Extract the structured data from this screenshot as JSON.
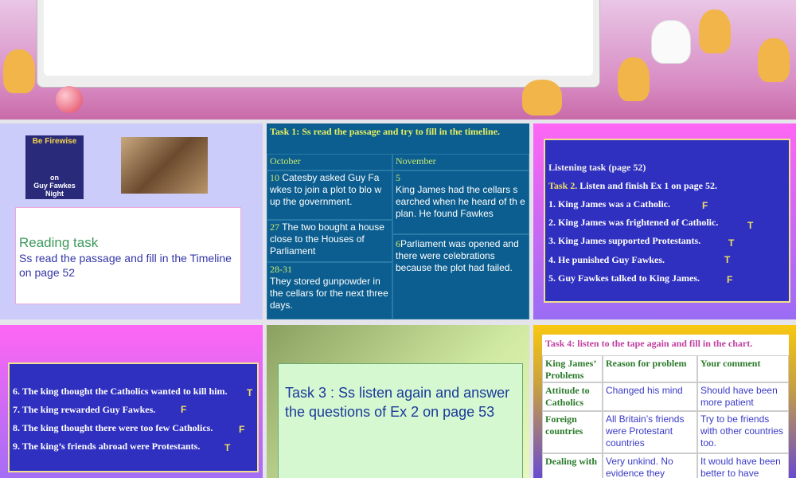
{
  "slide2": {
    "logo_top": "Be Firewise",
    "logo_mid": "on",
    "logo_bottom": "Guy Fawkes Night",
    "heading": "Reading task",
    "text": "Ss read the passage and fill in the Timeline on page 52"
  },
  "slide3": {
    "title": "Task 1: Ss read the passage and try to fill in the timeline.",
    "col1": "October",
    "col2": "November",
    "oct": [
      {
        "day": "10",
        "text": "Catesby asked Guy Fa wkes to join a plot to blo w up the government."
      },
      {
        "day": "27",
        "text": "The two bought a house close to the Houses of Parliament"
      },
      {
        "day": "28-31",
        "text": "They stored gunpowder in the cellars for the next three days."
      }
    ],
    "nov": [
      {
        "day": "5",
        "text": "King James had the cellars s earched when he heard of th e plan. He found Fawkes"
      },
      {
        "day": "6",
        "text": "Parliament was opened and there were celebrations because the plot had failed."
      }
    ]
  },
  "slide4": {
    "heading": "Listening task (page 52)",
    "task_label": "Task 2.",
    "task_text": " Listen and finish Ex 1 on page 52.",
    "items": [
      {
        "text": "1.  King James was a Catholic.",
        "answer": "F"
      },
      {
        "text": "2.  King James was frightened of Catholic.",
        "answer": "T"
      },
      {
        "text": "3.  King James supported Protestants.",
        "answer": "T"
      },
      {
        "text": "4.  He punished Guy Fawkes.",
        "answer": "T"
      },
      {
        "text": "5.  Guy Fawkes talked to King James.",
        "answer": "F"
      }
    ]
  },
  "slide5": {
    "items": [
      {
        "text": "6. The king thought the Catholics wanted to kill him.",
        "answer": "T"
      },
      {
        "text": "7. The king rewarded Guy Fawkes.",
        "answer": "F"
      },
      {
        "text": "8. The king thought there were too few Catholics.",
        "answer": "F"
      },
      {
        "text": "9. The king’s friends abroad were Protestants.",
        "answer": "T"
      }
    ]
  },
  "slide6": {
    "text": "Task 3 : Ss listen again and answer the questions of Ex 2 on page 53"
  },
  "slide7": {
    "title": "Task 4: listen to the tape again and fill in the chart.",
    "headers": [
      "King James’ Problems",
      "Reason for problem",
      "Your comment"
    ],
    "rows": [
      [
        "Attitude to Catholics",
        "Changed his mind",
        "Should have been more patient"
      ],
      [
        "Foreign countries",
        "All Britain’s friends were Protestant countries",
        "Try to be friends with other countries too."
      ],
      [
        "Dealing with",
        "Very unkind. No evidence they",
        "It would have been better to have"
      ]
    ]
  }
}
